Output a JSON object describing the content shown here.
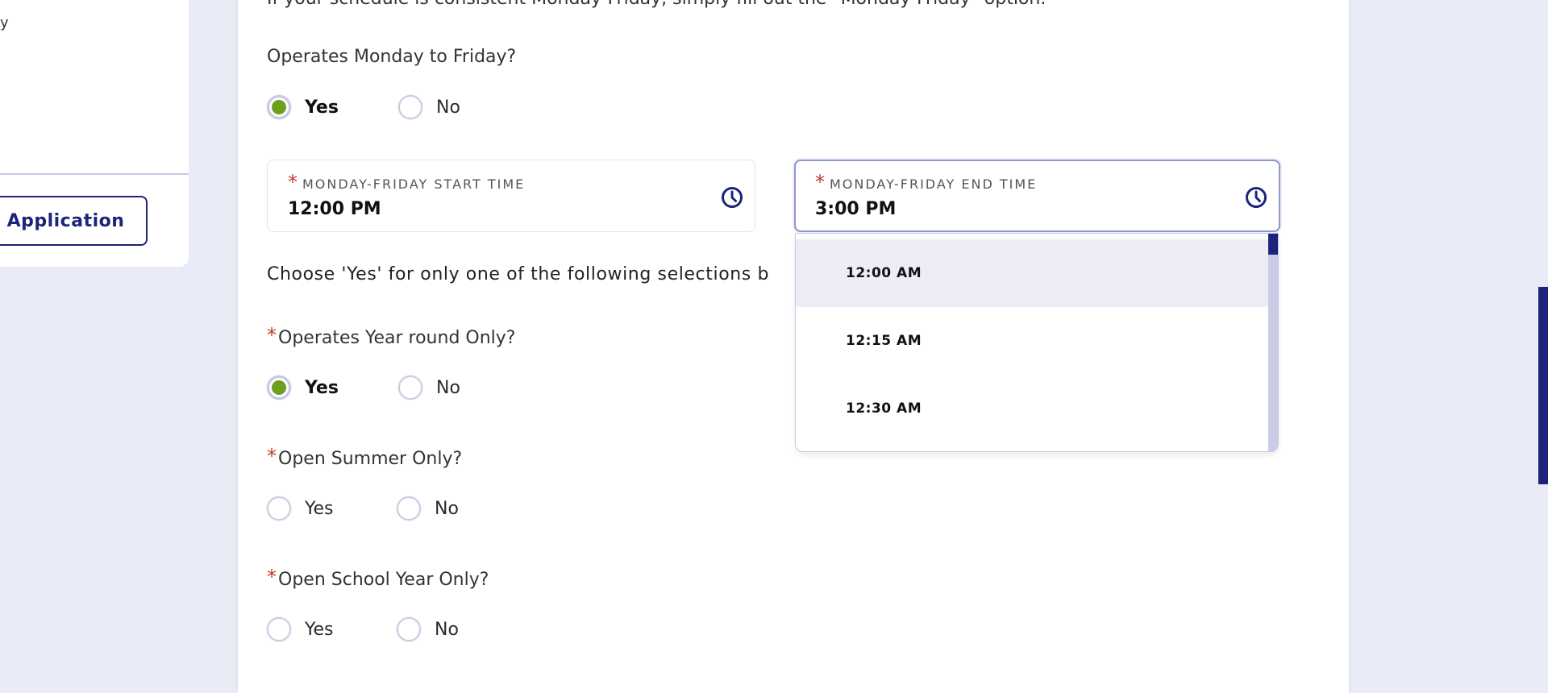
{
  "sidebar": {
    "fragment_text": "y",
    "application_button": "Application"
  },
  "intro_text": "If your schedule is consistent Monday-Friday, simply fill out the \"Monday-Friday\" option.",
  "q_monfri": {
    "label": "Operates Monday to Friday?",
    "yes": "Yes",
    "no": "No",
    "selected": "Yes"
  },
  "start_time": {
    "required_mark": "*",
    "label": "MONDAY-FRIDAY START TIME",
    "value": "12:00 PM",
    "icon": "clock-icon"
  },
  "end_time": {
    "required_mark": "*",
    "label": "MONDAY-FRIDAY END TIME",
    "value": "3:00 PM",
    "icon": "clock-icon"
  },
  "choose_text": "Choose 'Yes' for only one of the following selections b",
  "dropdown": {
    "options": [
      "12:00 AM",
      "12:15 AM",
      "12:30 AM"
    ],
    "highlighted": "12:00 AM"
  },
  "q_yearround": {
    "required_mark": "*",
    "label": "Operates Year round Only?",
    "yes": "Yes",
    "no": "No",
    "selected": "Yes"
  },
  "q_summer": {
    "required_mark": "*",
    "label": "Open Summer Only?",
    "yes": "Yes",
    "no": "No"
  },
  "q_school": {
    "required_mark": "*",
    "label": "Open School Year Only?",
    "yes": "Yes",
    "no": "No"
  },
  "colors": {
    "accent": "#1c2479",
    "radio_selected": "#6e9f1d",
    "required": "#c0392b",
    "background": "#e9ebf7"
  }
}
